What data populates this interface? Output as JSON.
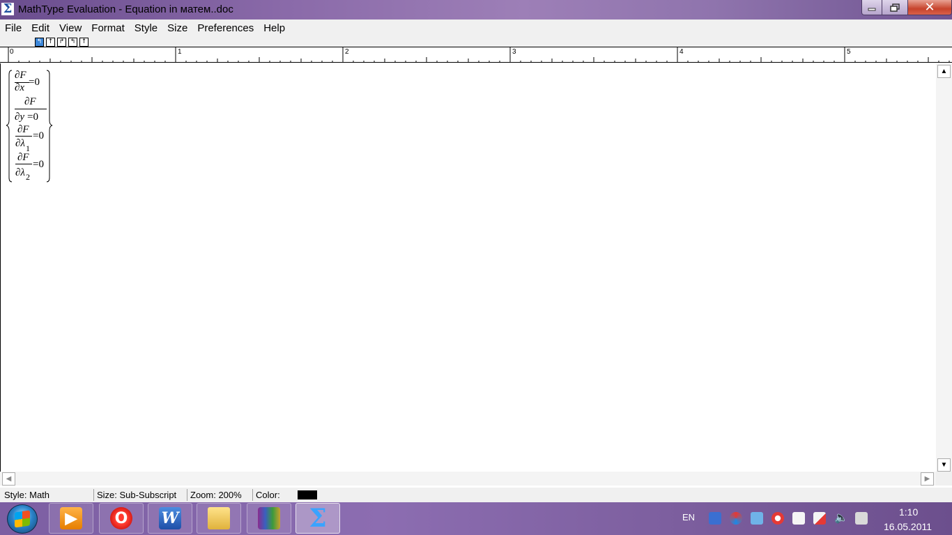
{
  "window": {
    "title": "MathType Evaluation - Equation in матем..doc",
    "app_icon": "Σ",
    "controls": {
      "minimize": "minimize-icon",
      "maximize": "restore-icon",
      "close": "✕"
    }
  },
  "menu": [
    "File",
    "Edit",
    "View",
    "Format",
    "Style",
    "Size",
    "Preferences",
    "Help"
  ],
  "tab_toolbar": {
    "active_index": 0
  },
  "ruler": {
    "labels": [
      "0",
      "1",
      "2",
      "3",
      "4",
      "5"
    ]
  },
  "equation": {
    "rows": [
      {
        "numerator": "∂F",
        "denominator": "∂x",
        "rhs": "=0"
      },
      {
        "numerator": "∂F",
        "denominator": "∂y",
        "rhs": "=0"
      },
      {
        "numerator": "∂F",
        "denominator": "∂λ",
        "sub": "1",
        "rhs": "=0"
      },
      {
        "numerator": "∂F",
        "denominator": "∂λ",
        "sub": "2",
        "rhs": "=0"
      }
    ]
  },
  "scrollbars": {
    "up": "▲",
    "down": "▼",
    "left": "◀",
    "right": "▶"
  },
  "statusbar": {
    "style": "Style: Math",
    "size": "Size: Sub-Subscript",
    "zoom": "Zoom: 200%",
    "color_label": "Color:",
    "color_value": "#000000"
  },
  "taskbar": {
    "apps": [
      {
        "name": "media-player-icon",
        "glyph": "▶"
      },
      {
        "name": "opera-icon",
        "glyph": "O"
      },
      {
        "name": "word-icon",
        "glyph": "W"
      },
      {
        "name": "explorer-folder-icon",
        "glyph": ""
      },
      {
        "name": "winrar-icon",
        "glyph": ""
      },
      {
        "name": "mathtype-icon",
        "glyph": "Σ"
      }
    ],
    "language": "EN",
    "time": "1:10",
    "date": "16.05.2011"
  }
}
